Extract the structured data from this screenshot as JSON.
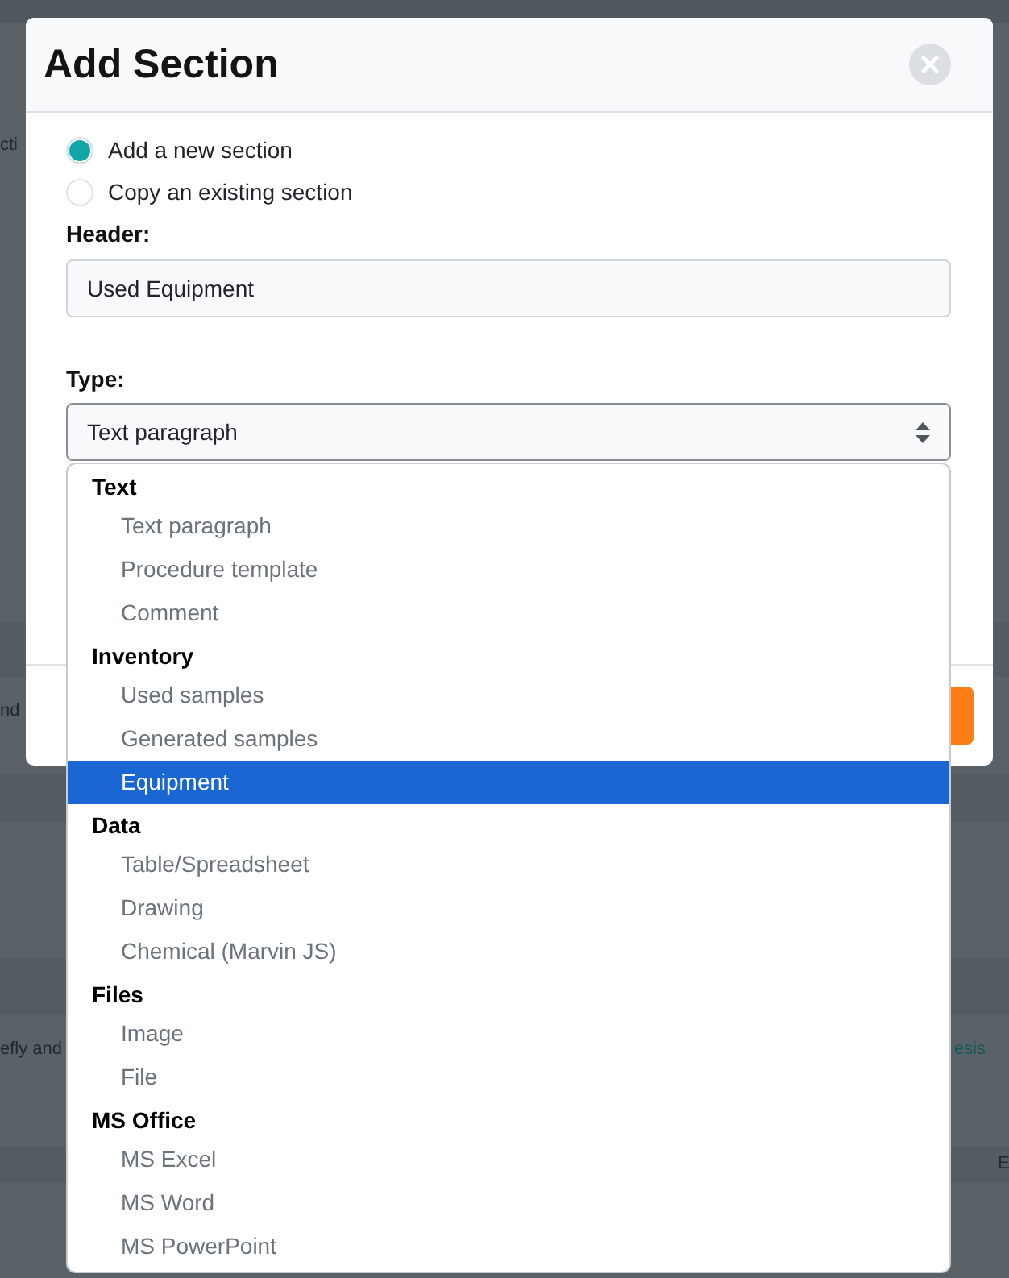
{
  "backdrop": {
    "fragments": [
      {
        "text": "cti",
        "kind": "text"
      },
      {
        "text": "nd",
        "kind": "text"
      },
      {
        "text": "efly and",
        "kind": "text"
      },
      {
        "text": "esis",
        "kind": "link"
      },
      {
        "text": "E",
        "kind": "text"
      }
    ]
  },
  "dialog": {
    "title": "Add Section",
    "mode_options": [
      {
        "label": "Add a new section",
        "selected": true
      },
      {
        "label": "Copy an existing section",
        "selected": false
      }
    ],
    "header_field": {
      "label": "Header:",
      "value": "Used Equipment"
    },
    "type_field": {
      "label": "Type:",
      "value": "Text paragraph",
      "expanded": true
    }
  },
  "type_dropdown": {
    "groups": [
      {
        "label": "Text",
        "options": [
          {
            "label": "Text paragraph",
            "selected": false
          },
          {
            "label": "Procedure template",
            "selected": false
          },
          {
            "label": "Comment",
            "selected": false
          }
        ]
      },
      {
        "label": "Inventory",
        "options": [
          {
            "label": "Used samples",
            "selected": false
          },
          {
            "label": "Generated samples",
            "selected": false
          },
          {
            "label": "Equipment",
            "selected": true
          }
        ]
      },
      {
        "label": "Data",
        "options": [
          {
            "label": "Table/Spreadsheet",
            "selected": false
          },
          {
            "label": "Drawing",
            "selected": false
          },
          {
            "label": "Chemical (Marvin JS)",
            "selected": false
          }
        ]
      },
      {
        "label": "Files",
        "options": [
          {
            "label": "Image",
            "selected": false
          },
          {
            "label": "File",
            "selected": false
          }
        ]
      },
      {
        "label": "MS Office",
        "options": [
          {
            "label": "MS Excel",
            "selected": false
          },
          {
            "label": "MS Word",
            "selected": false
          },
          {
            "label": "MS PowerPoint",
            "selected": false
          }
        ]
      }
    ]
  }
}
